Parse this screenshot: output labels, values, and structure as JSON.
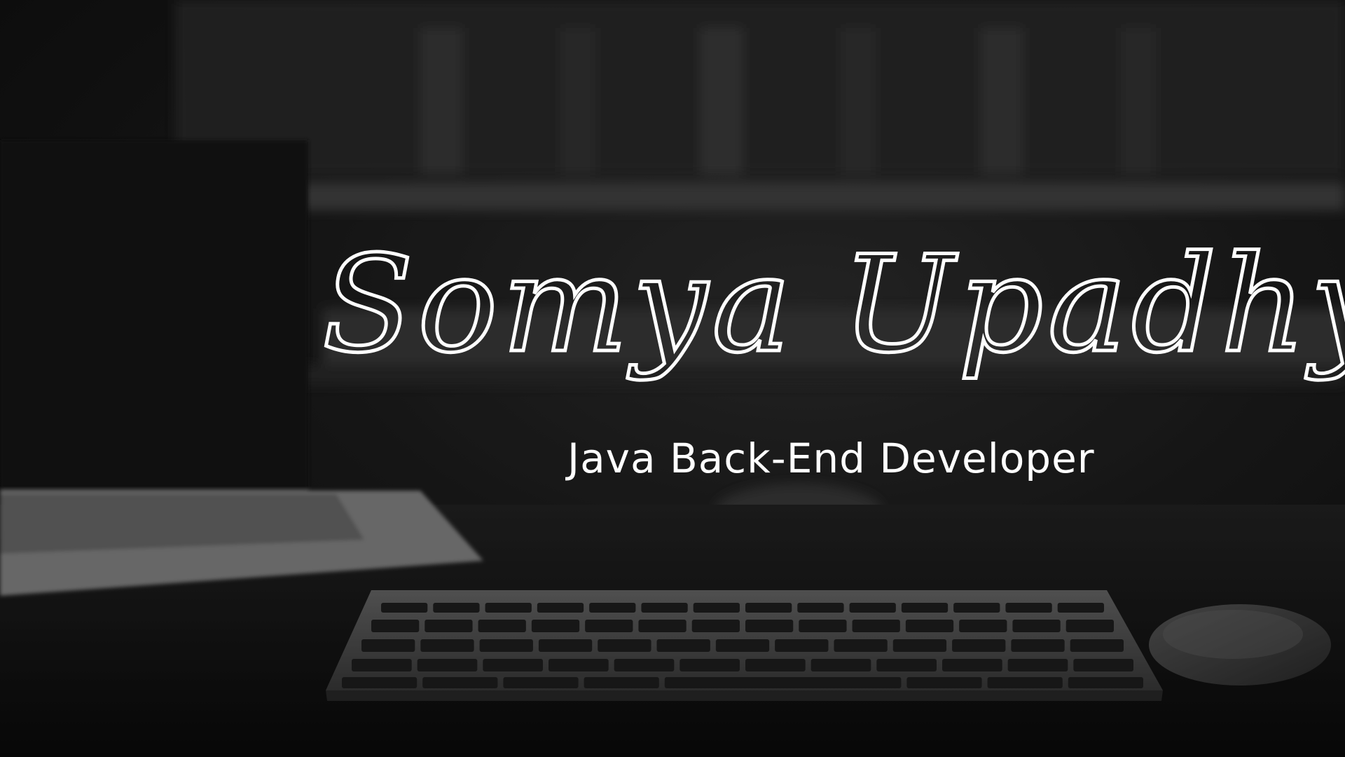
{
  "banner": {
    "name": "Somya Upadhyay",
    "role": "Java Back-End Developer"
  },
  "palette": {
    "background": "#1c1c1c",
    "text": "#ffffff"
  },
  "scene": {
    "objects": [
      "laptop",
      "keyboard",
      "mouse",
      "desk"
    ]
  }
}
